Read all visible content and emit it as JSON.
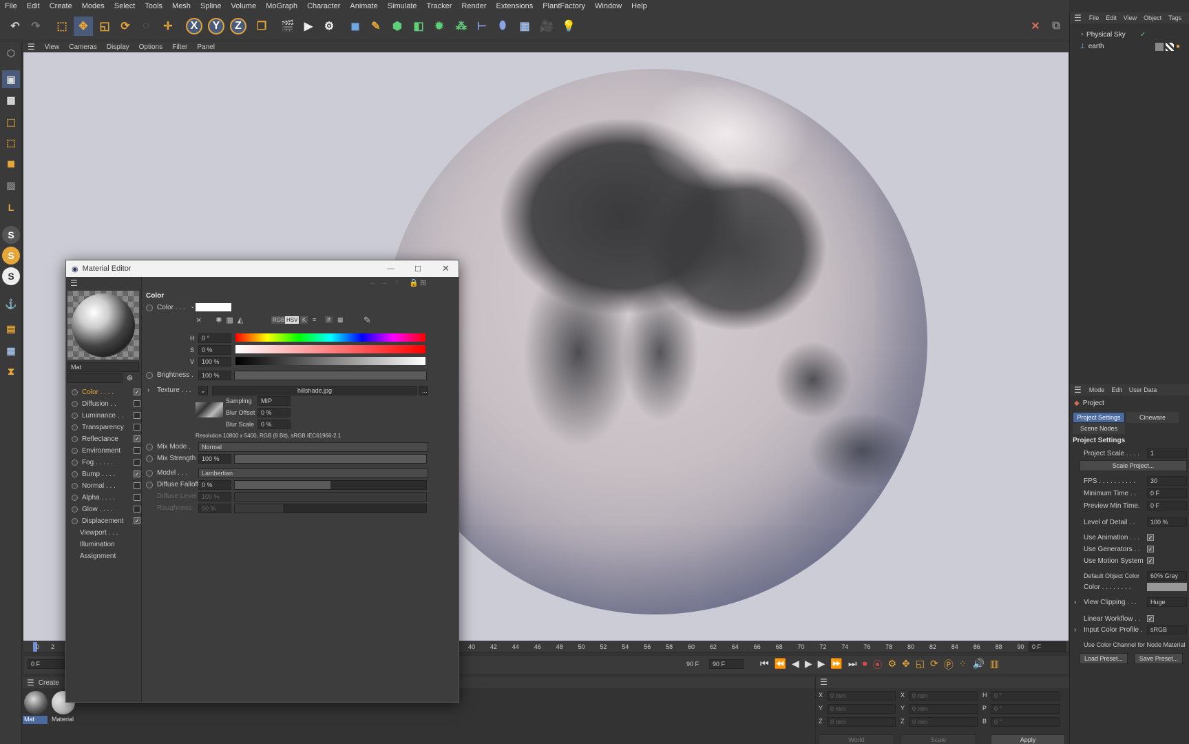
{
  "menubar": {
    "items": [
      "File",
      "Edit",
      "Create",
      "Modes",
      "Select",
      "Tools",
      "Mesh",
      "Spline",
      "Volume",
      "MoGraph",
      "Character",
      "Animate",
      "Simulate",
      "Tracker",
      "Render",
      "Extensions",
      "PlantFactory",
      "Window",
      "Help"
    ]
  },
  "toolbar": {
    "axis_x": "X",
    "axis_y": "Y",
    "axis_z": "Z"
  },
  "viewport_menu": {
    "items": [
      "View",
      "Cameras",
      "Display",
      "Options",
      "Filter",
      "Panel"
    ]
  },
  "timeline": {
    "ticks_left": [
      "0",
      "2"
    ],
    "ticks_right": [
      "40",
      "42",
      "44",
      "46",
      "48",
      "50",
      "52",
      "54",
      "56",
      "58",
      "60",
      "62",
      "64",
      "66",
      "68",
      "70",
      "72",
      "74",
      "76",
      "78",
      "80",
      "82",
      "84",
      "86",
      "88",
      "90"
    ],
    "frame_current": "0 F",
    "start_field": "0 F",
    "end_label": "90 F",
    "end_field": "90 F"
  },
  "material_manager": {
    "menu": "Create",
    "materials": [
      {
        "name": "Mat"
      },
      {
        "name": "Material"
      }
    ]
  },
  "coords": {
    "rows": [
      {
        "a": "X",
        "av": "0 mm",
        "b": "X",
        "bv": "0 mm",
        "c": "H",
        "cv": "0 °"
      },
      {
        "a": "Y",
        "av": "0 mm",
        "b": "Y",
        "bv": "0 mm",
        "c": "P",
        "cv": "0 °"
      },
      {
        "a": "Z",
        "av": "0 mm",
        "b": "Z",
        "bv": "0 mm",
        "c": "B",
        "cv": "0 °"
      }
    ],
    "world": "World",
    "scale": "Scale",
    "apply": "Apply"
  },
  "material_editor": {
    "title": "Material Editor",
    "name_field": "Mat",
    "channels": [
      {
        "label": "Color . . . .",
        "checked": true,
        "active": true
      },
      {
        "label": "Diffusion . .",
        "checked": false
      },
      {
        "label": "Luminance . .",
        "checked": false
      },
      {
        "label": "Transparency",
        "checked": false
      },
      {
        "label": "Reflectance",
        "checked": true
      },
      {
        "label": "Environment",
        "checked": false
      },
      {
        "label": "Fog . . . . .",
        "checked": false
      },
      {
        "label": "Bump . . . .",
        "checked": true
      },
      {
        "label": "Normal . . .",
        "checked": false
      },
      {
        "label": "Alpha . . . .",
        "checked": false
      },
      {
        "label": "Glow . . . .",
        "checked": false
      },
      {
        "label": "Displacement",
        "checked": true
      }
    ],
    "extra_items": [
      "Viewport . . .",
      "Illumination",
      "Assignment"
    ],
    "section_title": "Color",
    "color_label": "Color . . .",
    "color_mode_rgb": "RGB",
    "color_mode_hsv": "HSV",
    "color_mode_k": "K",
    "color_mode_hash": "#",
    "h_label": "H",
    "h_value": "0 °",
    "s_label": "S",
    "s_value": "0 %",
    "v_label": "V",
    "v_value": "100 %",
    "brightness_label": "Brightness .",
    "brightness_value": "100 %",
    "texture_label": "Texture . . .",
    "texture_file": "hillshade.jpg",
    "texture_more": "...",
    "sampling_label": "Sampling",
    "sampling_value": "MIP",
    "blur_offset_label": "Blur Offset",
    "blur_offset_value": "0 %",
    "blur_scale_label": "Blur Scale",
    "blur_scale_value": "0 %",
    "resolution": "Resolution 10800 x 5400, RGB (8 Bit), sRGB IEC61966-2.1",
    "mix_mode_label": "Mix Mode .",
    "mix_mode_value": "Normal",
    "mix_strength_label": "Mix Strength",
    "mix_strength_value": "100 %",
    "model_label": "Model . . .",
    "model_value": "Lambertian",
    "diffuse_falloff_label": "Diffuse Falloff",
    "diffuse_falloff_value": "0 %",
    "diffuse_level_label": "Diffuse Level",
    "diffuse_level_value": "100 %",
    "roughness_label": "Roughness .",
    "roughness_value": "50 %"
  },
  "object_manager": {
    "menu": [
      "File",
      "Edit",
      "View",
      "Object",
      "Tags"
    ],
    "objects": [
      {
        "name": "Physical Sky"
      },
      {
        "name": "earth"
      }
    ]
  },
  "attributes": {
    "menu": [
      "Mode",
      "Edit",
      "User Data"
    ],
    "object_label": "Project",
    "tabs": [
      "Project Settings",
      "Cineware",
      "Scene Nodes"
    ],
    "section": "Project Settings",
    "project_scale_label": "Project Scale . . . .",
    "project_scale_value": "1",
    "scale_project_btn": "Scale Project...",
    "fps_label": "FPS . . . . . . . . . .",
    "fps_value": "30",
    "min_time_label": "Minimum Time . .",
    "min_time_value": "0 F",
    "preview_min_label": "Preview Min Time.",
    "preview_min_value": "0 F",
    "lod_label": "Level of Detail . .",
    "lod_value": "100 %",
    "use_animation": "Use Animation . . .",
    "use_generators": "Use Generators . .",
    "use_motion": "Use Motion System",
    "default_color_label": "Default Object Color",
    "default_color_value": "60% Gray",
    "color_label": "Color . . . . . . . .",
    "view_clipping_label": "View Clipping . . .",
    "view_clipping_value": "Huge",
    "linear_workflow": "Linear Workflow . .",
    "input_profile_label": "Input Color Profile .",
    "input_profile_value": "sRGB",
    "use_color_channel": "Use Color Channel for Node Material",
    "load_preset": "Load Preset...",
    "save_preset": "Save Preset..."
  }
}
